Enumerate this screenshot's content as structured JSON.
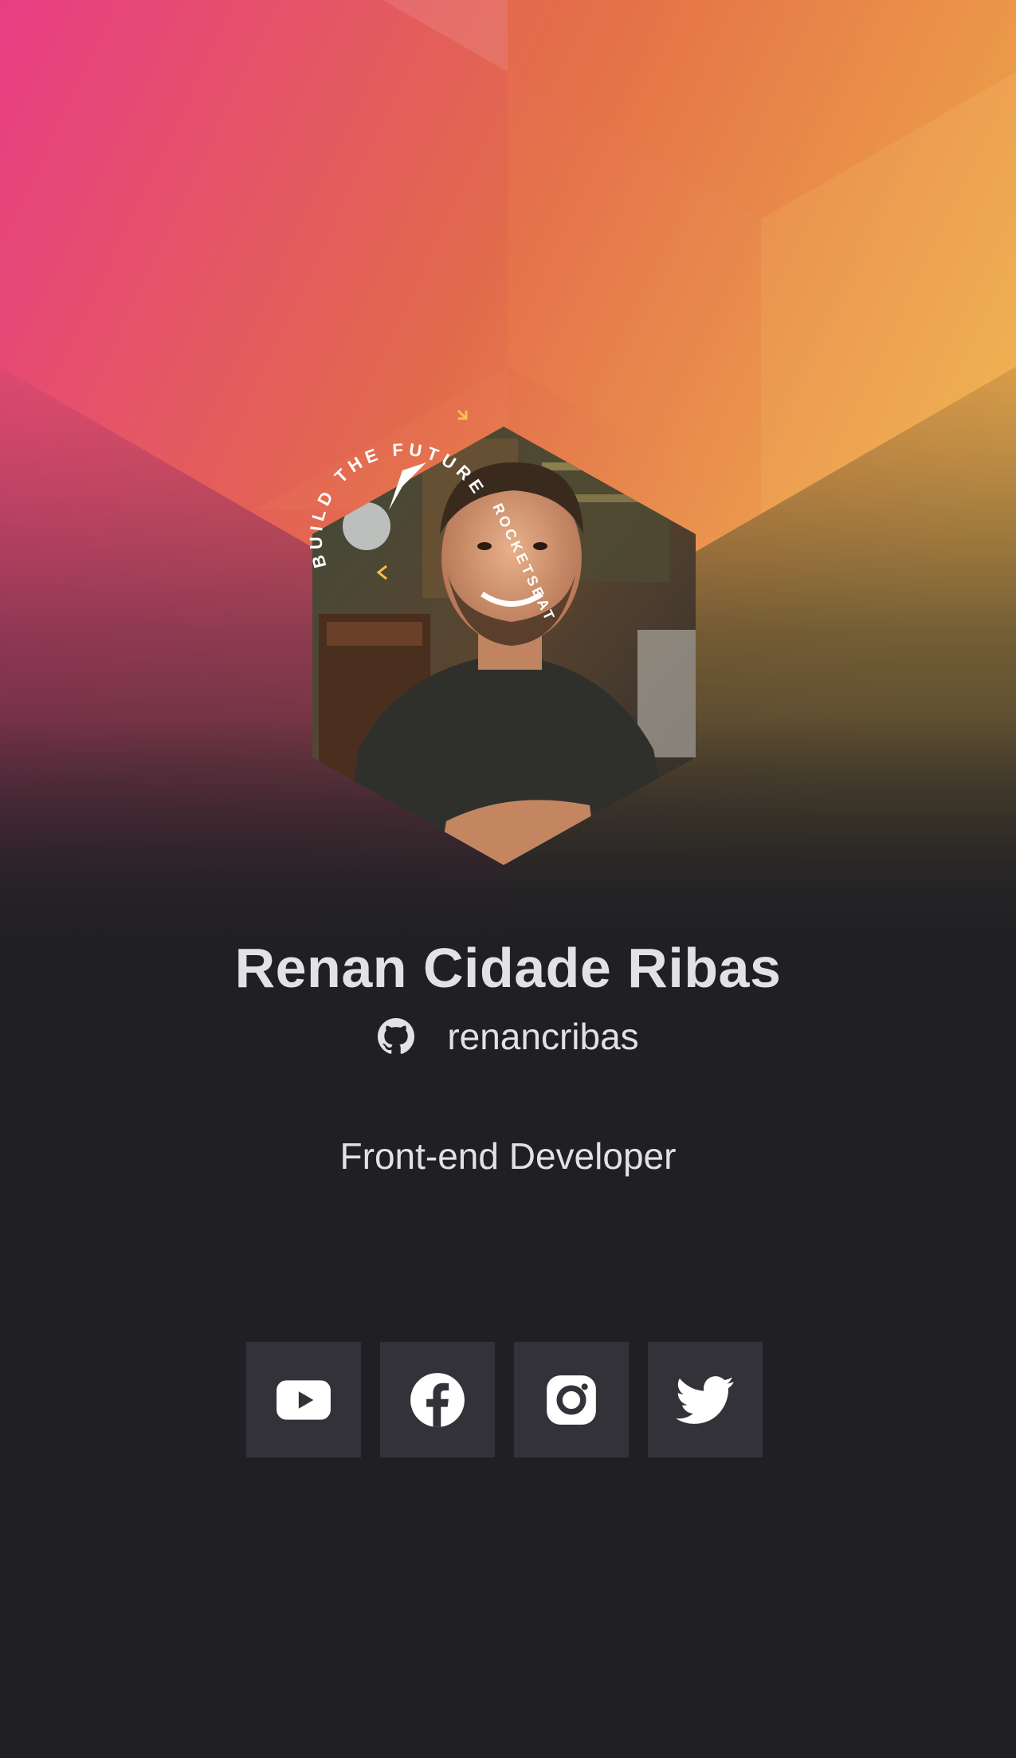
{
  "profile": {
    "name": "Renan Cidade Ribas",
    "github_username": "renancribas",
    "role": "Front-end Developer"
  },
  "badge": {
    "text": "BUILD THE FUTURE",
    "brand": "ROCKETSEAT"
  },
  "social": [
    {
      "name": "youtube",
      "icon": "youtube-icon"
    },
    {
      "name": "facebook",
      "icon": "facebook-icon"
    },
    {
      "name": "instagram",
      "icon": "instagram-icon"
    },
    {
      "name": "twitter",
      "icon": "twitter-icon"
    }
  ],
  "colors": {
    "background": "#202024",
    "card": "#323238",
    "text": "#e1e1e6",
    "gradient_pink": "#e83d84",
    "gradient_orange": "#e07340",
    "gradient_yellow": "#efb24f"
  }
}
